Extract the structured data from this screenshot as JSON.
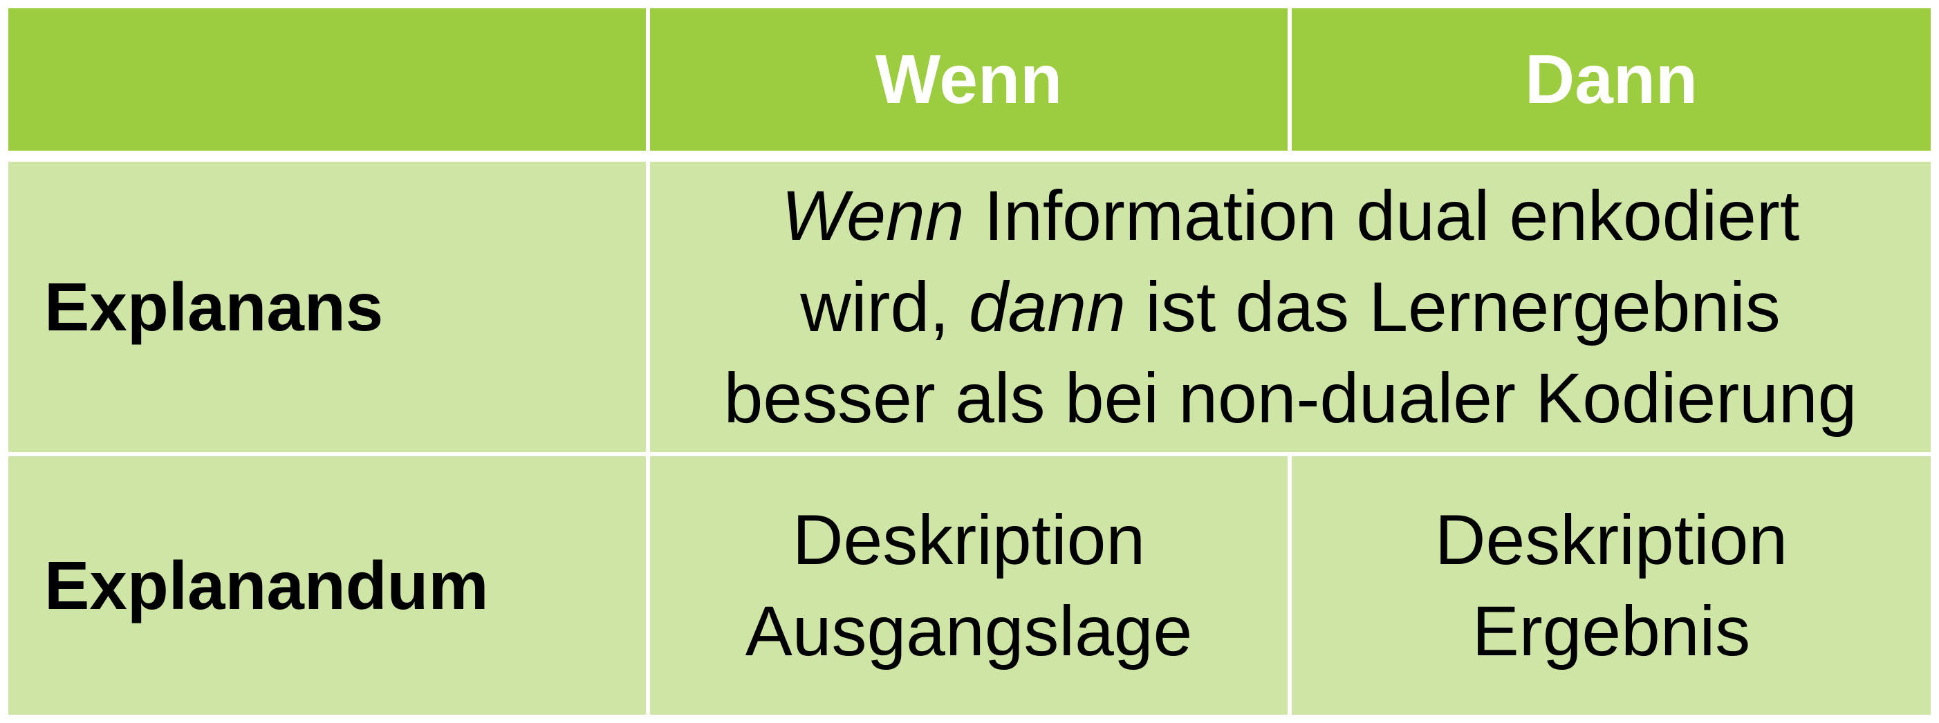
{
  "header": {
    "empty": "",
    "col_wenn": "Wenn",
    "col_dann": "Dann"
  },
  "rows": {
    "explanans": {
      "label": "Explanans",
      "line1_italic": "Wenn",
      "line1_rest": " Information dual enkodiert",
      "line2_start": "wird, ",
      "line2_italic": "dann",
      "line2_rest": " ist das Lernergebnis",
      "line3": "besser als bei non-dualer Kodierung"
    },
    "explanandum": {
      "label": "Explanandum",
      "wenn_line1": "Deskription",
      "wenn_line2": "Ausgangslage",
      "dann_line1": "Deskription",
      "dann_line2": "Ergebnis"
    }
  },
  "colors": {
    "header_bg": "#9ccc3f",
    "body_bg": "#cfe5a5",
    "border": "#ffffff"
  }
}
